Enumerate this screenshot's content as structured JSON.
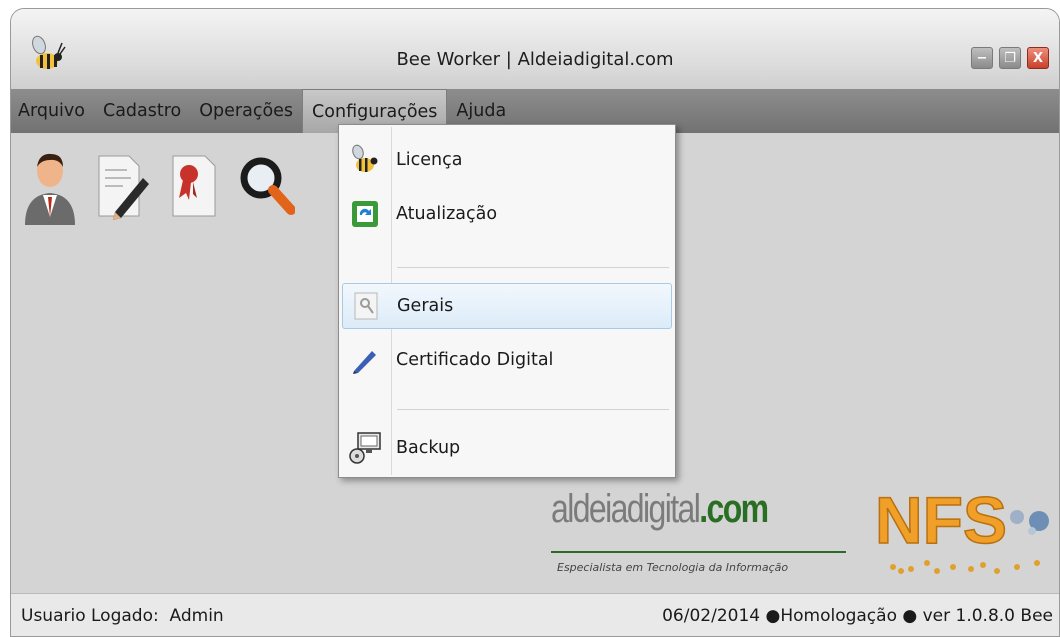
{
  "window": {
    "title": "Bee Worker | Aldeiadigital.com",
    "controls": {
      "minimize": "−",
      "maximize": "❐",
      "close": "X"
    }
  },
  "menubar": {
    "items": [
      {
        "label": "Arquivo"
      },
      {
        "label": "Cadastro"
      },
      {
        "label": "Operações"
      },
      {
        "label": "Configurações"
      },
      {
        "label": "Ajuda"
      }
    ],
    "active": "Configurações"
  },
  "toolbar": {
    "buttons": [
      {
        "icon": "user-icon"
      },
      {
        "icon": "edit-document-icon"
      },
      {
        "icon": "certificate-document-icon"
      },
      {
        "icon": "search-icon"
      }
    ]
  },
  "dropdown": {
    "items": [
      {
        "label": "Licença",
        "icon": "bee-icon"
      },
      {
        "label": "Atualização",
        "icon": "refresh-icon"
      },
      {
        "label": "Gerais",
        "icon": "settings-icon",
        "highlighted": true
      },
      {
        "label": "Certificado Digital",
        "icon": "pen-icon"
      },
      {
        "label": "Backup",
        "icon": "backup-icon"
      }
    ]
  },
  "branding": {
    "logo_main": "aldeiadigital",
    "logo_com": ".com",
    "tagline": "Especialista em Tecnologia da Informação",
    "nfs_text": "NFS"
  },
  "statusbar": {
    "user_label": "Usuario Logado:",
    "user_name": "Admin",
    "info": "06/02/2014 ●Homologação ● ver 1.0.8.0 Bee"
  },
  "colors": {
    "menubar": "#7f7f7f",
    "menu_highlight": "#dcebf8",
    "brand_green": "#2a6e23",
    "nfs_orange": "#f0a028"
  }
}
